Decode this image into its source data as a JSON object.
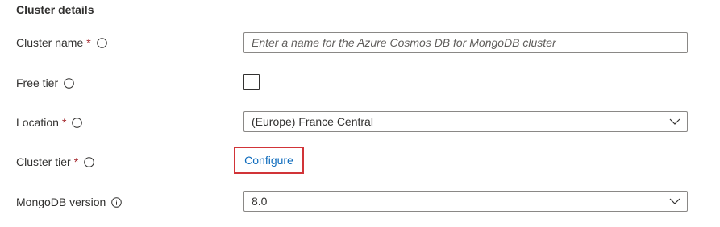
{
  "section": {
    "title": "Cluster details"
  },
  "fields": {
    "cluster_name": {
      "label": "Cluster name",
      "required_mark": "*",
      "placeholder": "Enter a name for the Azure Cosmos DB for MongoDB cluster",
      "value": ""
    },
    "free_tier": {
      "label": "Free tier",
      "checked": false
    },
    "location": {
      "label": "Location",
      "required_mark": "*",
      "selected": "(Europe) France Central"
    },
    "cluster_tier": {
      "label": "Cluster tier",
      "required_mark": "*",
      "link_label": "Configure"
    },
    "mongodb_version": {
      "label": "MongoDB version",
      "selected": "8.0"
    }
  },
  "colors": {
    "required": "#a4262c",
    "link": "#0f6cbd",
    "highlight_border": "#d13438",
    "input_border": "#8a8886"
  },
  "icons": {
    "info": "info-icon",
    "dropdown": "chevron-down-icon"
  }
}
